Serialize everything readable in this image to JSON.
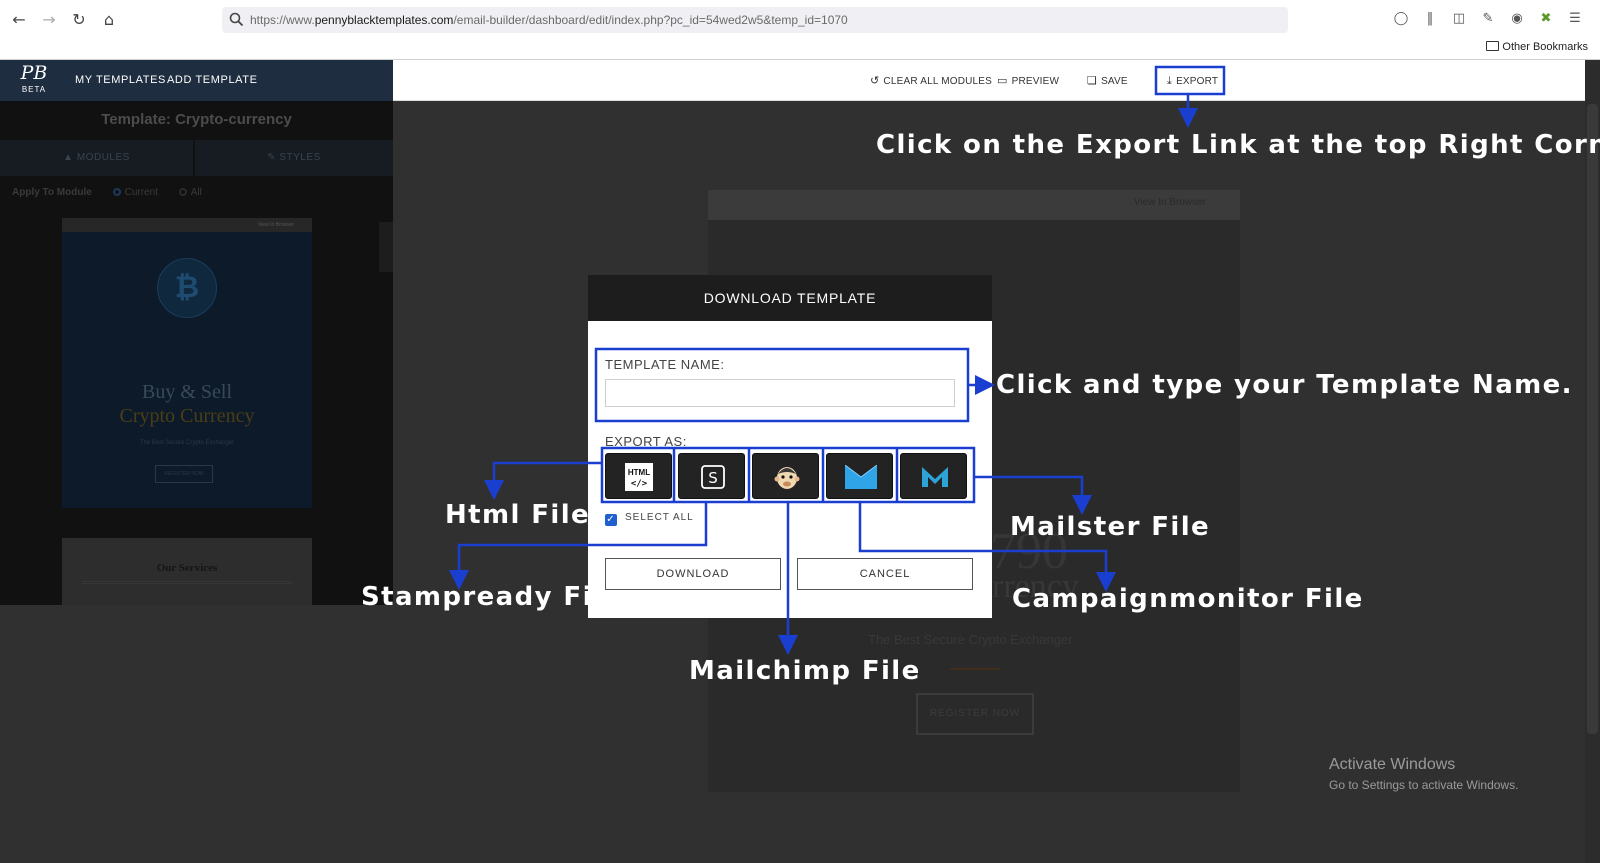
{
  "browser": {
    "url_prefix": "https://www.",
    "url_domain": "pennyblacktemplates.com",
    "url_path": "/email-builder/dashboard/edit/index.php?pc_id=54wed2w5&temp_id=1070",
    "bookmarks_label": "Other Bookmarks"
  },
  "app": {
    "logo_mono": "PB",
    "logo_tag": "BETA",
    "nav": [
      "MY TEMPLATES",
      "ADD TEMPLATE"
    ],
    "toolbar": {
      "clear": "CLEAR ALL MODULES",
      "preview": "PREVIEW",
      "save": "SAVE",
      "export": "EXPORT"
    }
  },
  "left_panel": {
    "template_title": "Template: Crypto-currency",
    "tabs": [
      "MODULES",
      "STYLES"
    ],
    "apply_label": "Apply To Module",
    "apply_options": [
      "Current",
      "All"
    ],
    "thumb_view_browser": "View In Browser",
    "thumb_heading_1": "Buy & Sell",
    "thumb_heading_2": "Crypto Currency",
    "thumb_sub": "The Best Secure Crypto Exchanger",
    "thumb_button": "REGISTER NOW",
    "thumb2_title": "Our Services"
  },
  "canvas": {
    "view_browser": "View In Browser",
    "ghost_big": "790",
    "ghost_word": "urrency",
    "ghost_sub": "The Best Secure Crypto Exchanger",
    "ghost_button": "REGISTER NOW"
  },
  "modal": {
    "title": "DOWNLOAD TEMPLATE",
    "template_name_label": "TEMPLATE NAME:",
    "template_name_value": "",
    "export_as_label": "EXPORT AS:",
    "select_all_label": "SELECT ALL",
    "download_label": "DOWNLOAD",
    "cancel_label": "CANCEL",
    "html_icon_text": "HTML",
    "html_icon_code": "</>",
    "stampready_letter": "S"
  },
  "annotations": {
    "export_hint": "Click on the Export Link at the top Right Corner",
    "name_hint": "Click and type your Template Name.",
    "html": "Html File",
    "stampready": "Stampready File",
    "mailchimp": "Mailchimp File",
    "mailster": "Mailster File",
    "campaignmonitor": "Campaignmonitor File",
    "accent_color": "#1a3fd0"
  },
  "watermark": {
    "line1": "Activate Windows",
    "line2": "Go to Settings to activate Windows."
  }
}
